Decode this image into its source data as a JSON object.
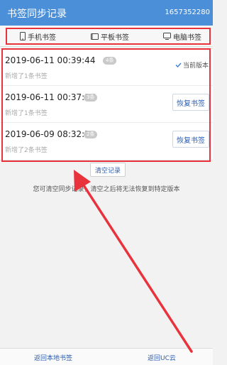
{
  "header": {
    "title": "书签同步记录",
    "account": "1657352280"
  },
  "tabs": [
    {
      "label": "手机书签",
      "icon": "phone-icon"
    },
    {
      "label": "平板书签",
      "icon": "tablet-icon"
    },
    {
      "label": "电脑书签",
      "icon": "monitor-icon"
    }
  ],
  "records": [
    {
      "time": "2019-06-11 00:39:44",
      "badge": "4条",
      "desc": "新增了1条书签",
      "status": "当前版本"
    },
    {
      "time": "2019-06-11 00:37:17",
      "badge": "3条",
      "desc": "新增了1条书签",
      "action": "恢复书签"
    },
    {
      "time": "2019-06-09 08:32:59",
      "badge": "2条",
      "desc": "新增了2条书签",
      "action": "恢复书签"
    }
  ],
  "clear_label": "清空记录",
  "hint": "您可清空同步记录，清空之后将无法恢复到特定版本",
  "footer": {
    "back_local": "返回本地书签",
    "back_uc": "返回UC云"
  },
  "colors": {
    "header": "#4a8fd8",
    "annotation": "#e8333c",
    "link": "#2a5db0"
  }
}
